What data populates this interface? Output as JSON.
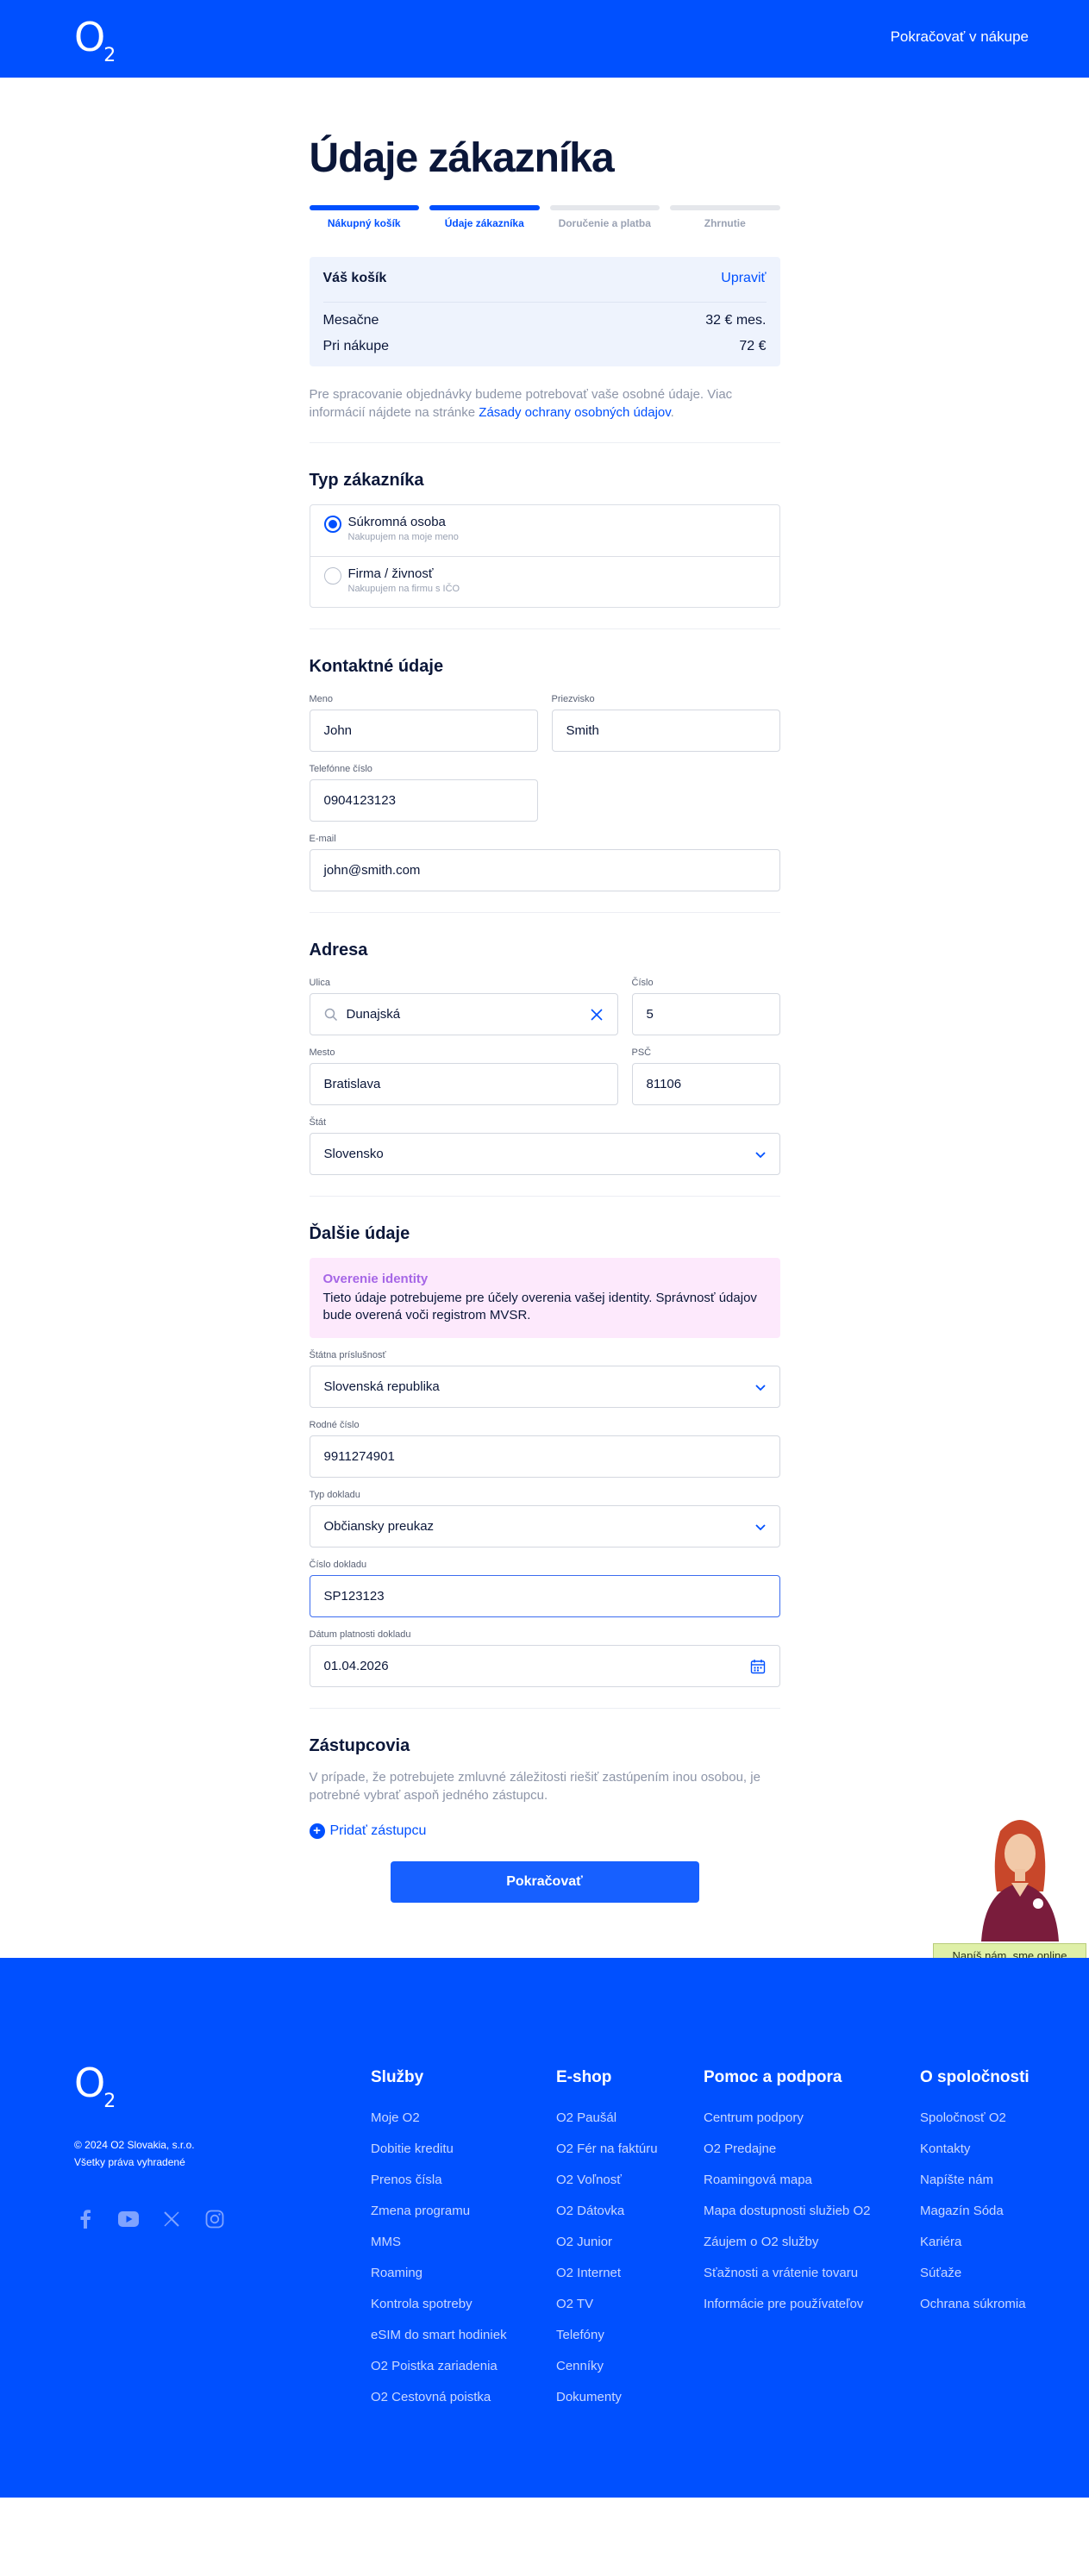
{
  "header": {
    "logo_o": "O",
    "logo_two": "2",
    "continue_shopping": "Pokračovať v nákupe"
  },
  "page_title": "Údaje zákazníka",
  "steps": [
    {
      "label": "Nákupný košík",
      "active": true
    },
    {
      "label": "Údaje zákazníka",
      "active": true
    },
    {
      "label": "Doručenie a platba",
      "active": false
    },
    {
      "label": "Zhrnutie",
      "active": false
    }
  ],
  "cart": {
    "title": "Váš košík",
    "edit": "Upraviť",
    "rows": [
      {
        "label": "Mesačne",
        "value": "32 € mes."
      },
      {
        "label": "Pri nákupe",
        "value": "72 €"
      }
    ]
  },
  "privacy": {
    "text": "Pre spracovanie objednávky budeme potrebovať vaše osobné údaje. Viac informácií nájdete na stránke ",
    "link": "Zásady ochrany osobných údajov",
    "end": "."
  },
  "customer_type": {
    "title": "Typ zákazníka",
    "options": [
      {
        "label": "Súkromná osoba",
        "sub": "Nakupujem na moje meno",
        "checked": true
      },
      {
        "label": "Firma / živnosť",
        "sub": "Nakupujem na firmu s IČO",
        "checked": false
      }
    ]
  },
  "contact": {
    "title": "Kontaktné údaje",
    "first_name_label": "Meno",
    "first_name": "John",
    "last_name_label": "Priezvisko",
    "last_name": "Smith",
    "phone_label": "Telefónne číslo",
    "phone": "0904123123",
    "email_label": "E-mail",
    "email": "john@smith.com"
  },
  "address": {
    "title": "Adresa",
    "street_label": "Ulica",
    "street": "Dunajská",
    "number_label": "Číslo",
    "number": "5",
    "city_label": "Mesto",
    "city": "Bratislava",
    "zip_label": "PSČ",
    "zip": "81106",
    "country_label": "Štát",
    "country": "Slovensko"
  },
  "other": {
    "title": "Ďalšie údaje",
    "notice_title": "Overenie identity",
    "notice_text": "Tieto údaje potrebujeme pre účely overenia vašej identity. Správnosť údajov bude overená voči registrom MVSR.",
    "nationality_label": "Štátna príslušnosť",
    "nationality": "Slovenská republika",
    "birth_number_label": "Rodné číslo",
    "birth_number": "9911274901",
    "doc_type_label": "Typ dokladu",
    "doc_type": "Občiansky preukaz",
    "doc_number_label": "Číslo dokladu",
    "doc_number": "SP123123",
    "doc_valid_label": "Dátum platnosti dokladu",
    "doc_valid": "01.04.2026"
  },
  "representatives": {
    "title": "Zástupcovia",
    "text": "V prípade, že potrebujete zmluvné záležitosti riešiť zastúpením inou osobou, je potrebné vybrať aspoň jedného zástupcu.",
    "add": "Pridať zástupcu"
  },
  "submit": "Pokračovať",
  "chat": {
    "bubble": "Napíš nám, sme online"
  },
  "footer": {
    "logo_o": "O",
    "logo_two": "2",
    "copyright": "© 2024 O2 Slovakia, s.r.o.",
    "rights": "Všetky práva vyhradené",
    "columns": [
      {
        "title": "Služby",
        "items": [
          "Moje O2",
          "Dobitie kreditu",
          "Prenos čísla",
          "Zmena programu",
          "MMS",
          "Roaming",
          "Kontrola spotreby",
          "eSIM do smart hodiniek",
          "O2 Poistka zariadenia",
          "O2 Cestovná poistka"
        ]
      },
      {
        "title": "E-shop",
        "items": [
          "O2 Paušál",
          "O2 Fér na faktúru",
          "O2 Voľnosť",
          "O2 Dátovka",
          "O2 Junior",
          "O2 Internet",
          "O2 TV",
          "Telefóny",
          "Cenníky",
          "Dokumenty"
        ]
      },
      {
        "title": "Pomoc a podpora",
        "items": [
          "Centrum podpory",
          "O2 Predajne",
          "Roamingová mapa",
          "Mapa dostupnosti služieb O2",
          "Záujem o O2 služby",
          "Sťažnosti a vrátenie tovaru",
          "Informácie pre používateľov"
        ]
      },
      {
        "title": "O spoločnosti",
        "items": [
          "Spoločnosť O2",
          "Kontakty",
          "Napíšte nám",
          "Magazín Sóda",
          "Kariéra",
          "Súťaže",
          "Ochrana súkromia"
        ]
      }
    ]
  },
  "colors": {
    "brand": "#0050ff",
    "button": "#1760ff",
    "notice_bg": "#fde9fc",
    "notice_title": "#a666e6",
    "cart_bg": "#eef3fd"
  },
  "icons": [
    "search-icon",
    "close-icon",
    "chevron-down-icon",
    "calendar-icon",
    "plus-icon",
    "facebook-icon",
    "youtube-icon",
    "x-icon",
    "instagram-icon"
  ]
}
